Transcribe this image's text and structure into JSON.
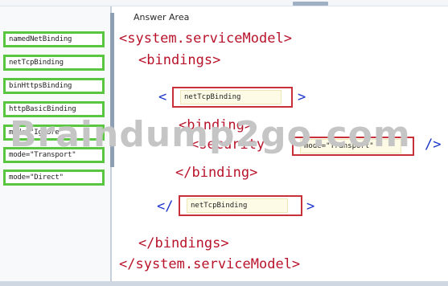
{
  "answer_area": {
    "title": "Answer Area"
  },
  "source_tiles": [
    {
      "label": "namedNetBinding"
    },
    {
      "label": "netTcpBinding"
    },
    {
      "label": "binHttpsBinding"
    },
    {
      "label": "httpBasicBinding"
    },
    {
      "label": "mode=\"Ignore\""
    },
    {
      "label": "mode=\"Transport\""
    },
    {
      "label": "mode=\"Direct\""
    }
  ],
  "code": {
    "line1": "<system.serviceModel>",
    "line2": "<bindings>",
    "open_lt": "<",
    "open_gt": ">",
    "binding_open": "<binding>",
    "binding_attr_prefix": "<security",
    "self_close": "/>",
    "binding_close": "</binding>",
    "close_lt": "</",
    "close_gt": ">",
    "bindings_close": "</bindings>",
    "model_close": "</system.serviceModel>"
  },
  "slots": {
    "open_binding_type": "netTcpBinding",
    "security_mode": "mode=\"Transport\"",
    "close_binding_type": "netTcpBinding"
  },
  "watermark": "Braindump2go.com",
  "colors": {
    "tile_border": "#58c73f",
    "slot_border": "#c8303a",
    "tag": "#b8132b",
    "punct": "#1b34c9"
  }
}
